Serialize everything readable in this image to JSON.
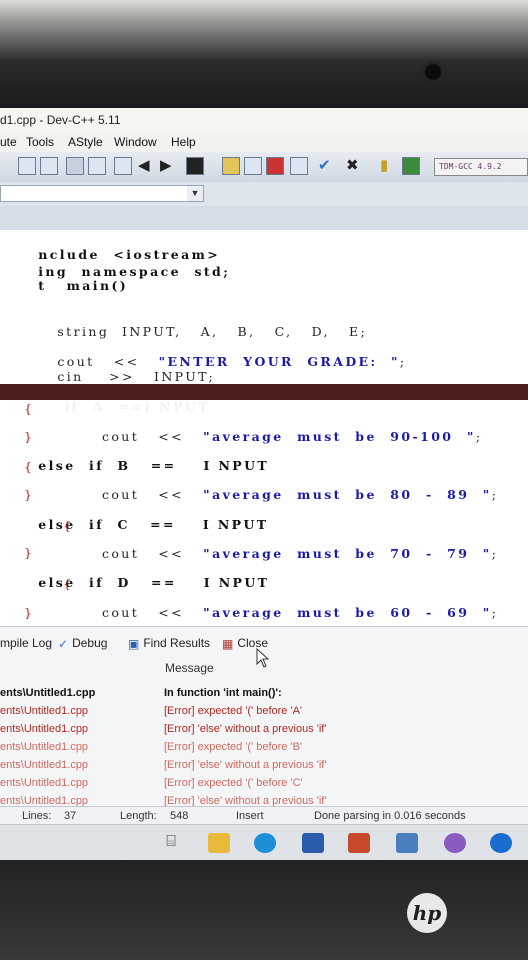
{
  "window": {
    "title": "d1.cpp - Dev-C++ 5.11"
  },
  "menu": [
    "ute",
    "Tools",
    "AStyle",
    "Window",
    "Help"
  ],
  "toolbar": {
    "compiler": "TDM-GCC 4.9.2"
  },
  "code": {
    "l1": "nclude  <iostream>",
    "l2": "ing  namespace  std;",
    "l3": "t   main()",
    "l4": "   string  INPUT,   A,   B,   C,   D,   E;",
    "l5_cout": "   cout   <<   ",
    "l5_str": "\"ENTER  YOUR  GRADE:  \"",
    "l5_end": ";",
    "l6": "   cin    >>   INPUT;",
    "l7": "  if  A  ==I NPUT",
    "l8": "{",
    "l9_cout": "          cout   <<   ",
    "l9_str": "\"average  must  be  90-100  \"",
    "l9_end": ";",
    "l10": "}",
    "l11": "else  if  B   ==    I NPUT",
    "l12": "{",
    "l13_cout": "          cout   <<   ",
    "l13_str": "\"average  must  be  80  -  89  \"",
    "l13_end": ";",
    "l14": "}",
    "l15": "else  if  C   ==    I NPUT",
    "l16": "   {",
    "l17_cout": "          cout   <<   ",
    "l17_str": "\"average  must  be  70  -  79  \"",
    "l17_end": ";",
    "l18": "}",
    "l19": "else  if  D   ==    I NPUT",
    "l20": "   {",
    "l21_cout": "          cout   <<   ",
    "l21_str": "\"average  must  be  60  -  69  \"",
    "l21_end": ";",
    "l22": "}"
  },
  "panel": {
    "tabs": [
      "mpile Log",
      "Debug",
      "Find Results",
      "Close"
    ],
    "message_header": "Message",
    "rows": [
      {
        "file": "ents\\Untitled1.cpp",
        "message": "In function 'int main()':"
      },
      {
        "file": "ents\\Untitled1.cpp",
        "message": "[Error] expected '(' before 'A'"
      },
      {
        "file": "ents\\Untitled1.cpp",
        "message": "[Error] 'else' without a previous 'if'"
      },
      {
        "file": "ents\\Untitled1.cpp",
        "message": "[Error] expected '(' before 'B'"
      },
      {
        "file": "ents\\Untitled1.cpp",
        "message": "[Error] 'else' without a previous 'if'"
      },
      {
        "file": "ents\\Untitled1.cpp",
        "message": "[Error] expected '(' before 'C'"
      },
      {
        "file": "ents\\Untitled1.cpp",
        "message": "[Error] 'else' without a previous 'if'"
      }
    ]
  },
  "status": {
    "lines_label": "Lines:",
    "lines_value": "37",
    "length_label": "Length:",
    "length_value": "548",
    "mode": "Insert",
    "parse": "Done parsing in 0.016 seconds"
  },
  "brand": {
    "logo": "hp"
  },
  "colors": {
    "error": "#b4291f",
    "highlight_line": "#4d1e1e",
    "string": "#1a1aa8"
  }
}
